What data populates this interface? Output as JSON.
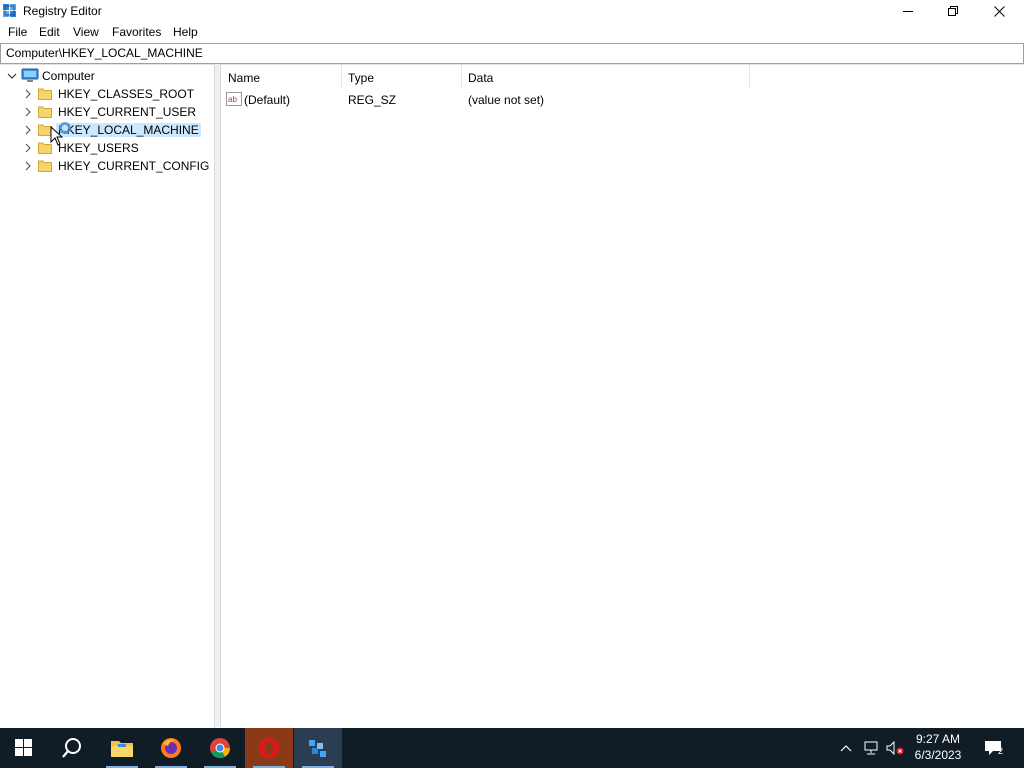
{
  "window": {
    "title": "Registry Editor"
  },
  "menu": {
    "items": [
      "File",
      "Edit",
      "View",
      "Favorites",
      "Help"
    ]
  },
  "address": {
    "path": "Computer\\HKEY_LOCAL_MACHINE"
  },
  "tree": {
    "root": "Computer",
    "children": [
      {
        "label": "HKEY_CLASSES_ROOT",
        "selected": false
      },
      {
        "label": "HKEY_CURRENT_USER",
        "selected": false
      },
      {
        "label": "HKEY_LOCAL_MACHINE",
        "selected": true
      },
      {
        "label": "HKEY_USERS",
        "selected": false
      },
      {
        "label": "HKEY_CURRENT_CONFIG",
        "selected": false
      }
    ]
  },
  "list": {
    "columns": [
      "Name",
      "Type",
      "Data"
    ],
    "rows": [
      {
        "name": "(Default)",
        "type": "REG_SZ",
        "data": "(value not set)",
        "icon": "string-value-icon"
      }
    ]
  },
  "taskbar": {
    "apps": [
      "start-icon",
      "search-icon",
      "file-explorer-icon",
      "firefox-icon",
      "chrome-icon",
      "opera-icon",
      "registry-editor-icon"
    ],
    "time": "9:27 AM",
    "date": "6/3/2023",
    "notification_count": "2"
  },
  "colors": {
    "selection": "#cce8ff",
    "taskbar": "#101c26",
    "folder": "#f6d36b"
  }
}
